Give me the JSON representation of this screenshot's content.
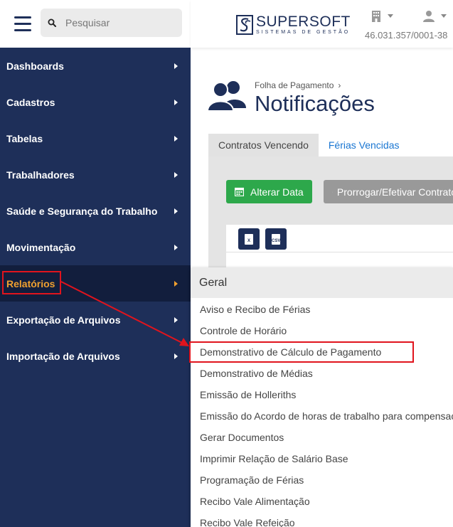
{
  "search": {
    "placeholder": "Pesquisar"
  },
  "sidebar": {
    "items": [
      {
        "label": "Dashboards"
      },
      {
        "label": "Cadastros"
      },
      {
        "label": "Tabelas"
      },
      {
        "label": "Trabalhadores"
      },
      {
        "label": "Saúde e Segurança do Trabalho"
      },
      {
        "label": "Movimentação"
      },
      {
        "label": "Relatórios"
      },
      {
        "label": "Exportação de Arquivos"
      },
      {
        "label": "Importação de Arquivos"
      }
    ]
  },
  "header": {
    "logo_name": "SUPERSOFT",
    "logo_tagline": "SISTEMAS DE GESTÃO",
    "cnpj": "46.031.357/0001-38"
  },
  "page": {
    "breadcrumb": "Folha de Pagamento",
    "title": "Notificações",
    "tabs": [
      {
        "label": "Contratos Vencendo"
      },
      {
        "label": "Férias Vencidas"
      }
    ],
    "alterar_label": "Alterar Data",
    "prorrogar_label": "Prorrogar/Efetivar Contratos",
    "export_xls": "X",
    "export_csv": "CSV"
  },
  "dropdown": {
    "heading": "Geral",
    "items": [
      "Aviso e Recibo de Férias",
      "Controle de Horário",
      "Demonstrativo de Cálculo de Pagamento",
      "Demonstrativo de Médias",
      "Emissão de Holleriths",
      "Emissão do Acordo de horas de trabalho para compensação",
      "Gerar Documentos",
      "Imprimir Relação de Salário Base",
      "Programação de Férias",
      "Recibo Vale Alimentação",
      "Recibo Vale Refeição"
    ]
  },
  "colors": {
    "sidebar_bg": "#1e2f59",
    "active_bg": "#121e3d",
    "active_text": "#f0a030",
    "primary_green": "#2da84b",
    "link_blue": "#1976d2",
    "annotation_red": "#e0141d"
  }
}
